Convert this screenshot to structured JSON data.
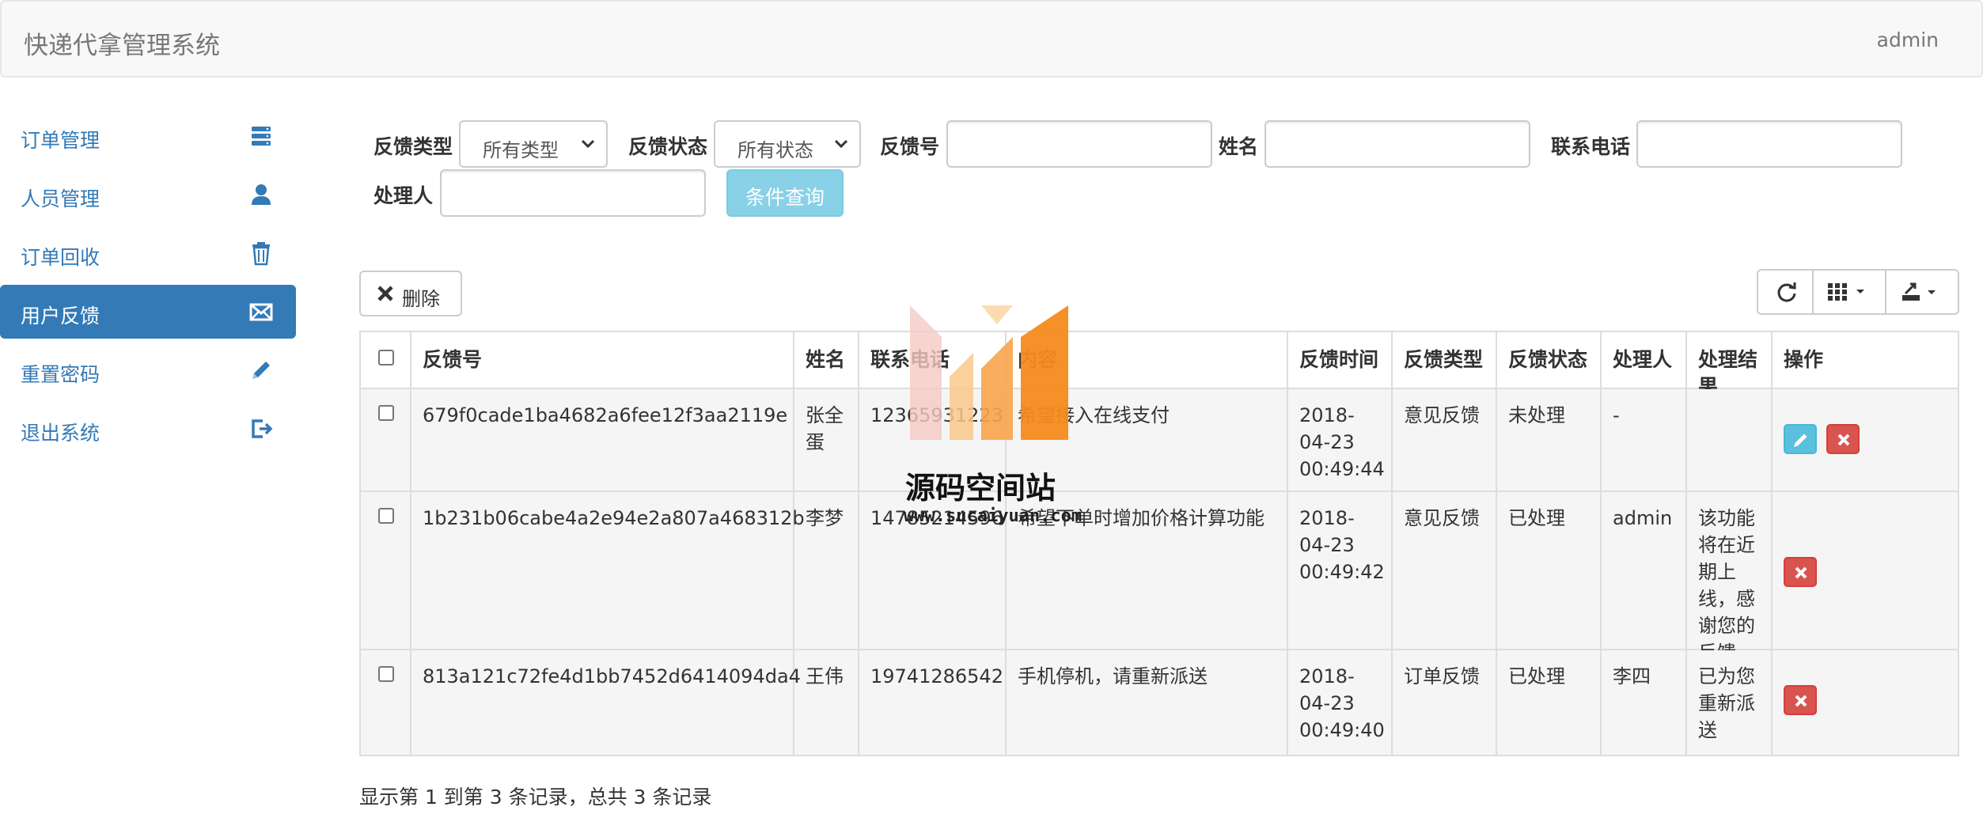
{
  "navbar": {
    "brand": "快递代拿管理系统",
    "user": "admin"
  },
  "sidebar": {
    "items": [
      {
        "label": "订单管理",
        "icon": "server-icon",
        "active": false
      },
      {
        "label": "人员管理",
        "icon": "user-icon",
        "active": false
      },
      {
        "label": "订单回收",
        "icon": "trash-icon",
        "active": false
      },
      {
        "label": "用户反馈",
        "icon": "envelope-icon",
        "active": true
      },
      {
        "label": "重置密码",
        "icon": "pencil-icon",
        "active": false
      },
      {
        "label": "退出系统",
        "icon": "logout-icon",
        "active": false
      }
    ]
  },
  "filters": {
    "type_label": "反馈类型",
    "type_value": "所有类型",
    "status_label": "反馈状态",
    "status_value": "所有状态",
    "id_label": "反馈号",
    "name_label": "姓名",
    "phone_label": "联系电话",
    "handler_label": "处理人",
    "query_button": "条件查询"
  },
  "toolbar": {
    "delete_label": "删除"
  },
  "table": {
    "headers": [
      "反馈号",
      "姓名",
      "联系电话",
      "内容",
      "反馈时间",
      "反馈类型",
      "反馈状态",
      "处理人",
      "处理结果",
      "操作"
    ],
    "rows": [
      {
        "id": "679f0cade1ba4682a6fee12f3aa2119e",
        "name": "张全蛋",
        "phone": "12365931223",
        "content": "希望接入在线支付",
        "time": "2018-04-23 00:49:44",
        "type": "意见反馈",
        "status": "未处理",
        "handler": "-",
        "result": ""
      },
      {
        "id": "1b231b06cabe4a2e94e2a807a468312b",
        "name": "李梦",
        "phone": "14785214596",
        "content": "希望下单时增加价格计算功能",
        "time": "2018-04-23 00:49:42",
        "type": "意见反馈",
        "status": "已处理",
        "handler": "admin",
        "result": "该功能将在近期上线，感谢您的反馈。"
      },
      {
        "id": "813a121c72fe4d1bb7452d6414094da4",
        "name": "王伟",
        "phone": "19741286542",
        "content": "手机停机，请重新派送",
        "time": "2018-04-23 00:49:40",
        "type": "订单反馈",
        "status": "已处理",
        "handler": "李四",
        "result": "已为您重新派送"
      }
    ]
  },
  "footer": {
    "summary": "显示第 1 到第 3 条记录，总共 3 条记录"
  },
  "watermark": {
    "title": "源码空间站",
    "url": "www.sucaiyuan.com"
  },
  "colors": {
    "primary": "#337ab7",
    "info": "#5bc0de",
    "danger": "#d9534f",
    "navbar_bg": "#f8f8f8"
  }
}
